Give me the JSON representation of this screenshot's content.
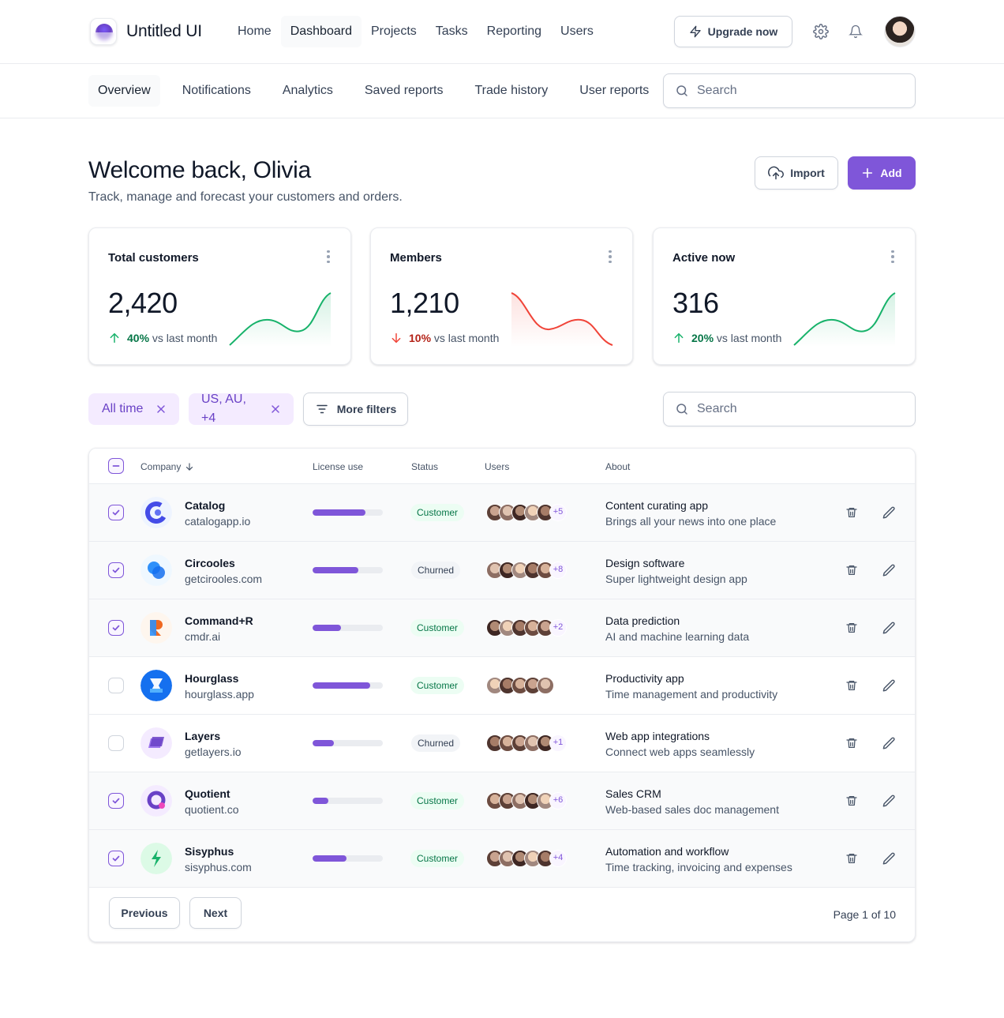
{
  "app": {
    "name": "Untitled UI"
  },
  "nav": {
    "items": [
      {
        "label": "Home",
        "active": false
      },
      {
        "label": "Dashboard",
        "active": true
      },
      {
        "label": "Projects",
        "active": false
      },
      {
        "label": "Tasks",
        "active": false
      },
      {
        "label": "Reporting",
        "active": false
      },
      {
        "label": "Users",
        "active": false
      }
    ],
    "upgrade_label": "Upgrade now",
    "icons": [
      "zap-icon",
      "settings-icon",
      "bell-icon"
    ]
  },
  "subnav": {
    "items": [
      {
        "label": "Overview",
        "active": true
      },
      {
        "label": "Notifications",
        "active": false
      },
      {
        "label": "Analytics",
        "active": false
      },
      {
        "label": "Saved reports",
        "active": false
      },
      {
        "label": "Trade history",
        "active": false
      },
      {
        "label": "User reports",
        "active": false
      }
    ],
    "search_placeholder": "Search"
  },
  "header": {
    "title": "Welcome back, Olivia",
    "subtitle": "Track, manage and forecast your customers and orders.",
    "import_label": "Import",
    "add_label": "Add"
  },
  "metrics": [
    {
      "title": "Total customers",
      "value": "2,420",
      "pct": "40%",
      "trend_text": "vs last month",
      "direction": "up",
      "color": "#17b26a"
    },
    {
      "title": "Members",
      "value": "1,210",
      "pct": "10%",
      "trend_text": "vs last month",
      "direction": "down",
      "color": "#f04438"
    },
    {
      "title": "Active now",
      "value": "316",
      "pct": "20%",
      "trend_text": "vs last month",
      "direction": "up",
      "color": "#17b26a"
    }
  ],
  "filters": {
    "chips": [
      {
        "label": "All time"
      },
      {
        "label": "US, AU, +4"
      }
    ],
    "more_label": "More filters",
    "search_placeholder": "Search"
  },
  "table": {
    "columns": {
      "company": "Company",
      "license": "License use",
      "status": "Status",
      "users": "Users",
      "about": "About"
    },
    "rows": [
      {
        "name": "Catalog",
        "domain": "catalogapp.io",
        "license": 0.75,
        "status": "Customer",
        "extra_users": "+5",
        "about_title": "Content curating app",
        "about_desc": "Brings all your news into one place",
        "checked": true,
        "logo": "catalog"
      },
      {
        "name": "Circooles",
        "domain": "getcirooles.com",
        "license": 0.65,
        "status": "Churned",
        "extra_users": "+8",
        "about_title": "Design software",
        "about_desc": "Super lightweight design app",
        "checked": true,
        "logo": "circooles"
      },
      {
        "name": "Command+R",
        "domain": "cmdr.ai",
        "license": 0.4,
        "status": "Customer",
        "extra_users": "+2",
        "about_title": "Data prediction",
        "about_desc": "AI and machine learning data",
        "checked": true,
        "logo": "commandr"
      },
      {
        "name": "Hourglass",
        "domain": "hourglass.app",
        "license": 0.82,
        "status": "Customer",
        "extra_users": "",
        "about_title": "Productivity app",
        "about_desc": "Time management and productivity",
        "checked": false,
        "logo": "hourglass"
      },
      {
        "name": "Layers",
        "domain": "getlayers.io",
        "license": 0.3,
        "status": "Churned",
        "extra_users": "+1",
        "about_title": "Web app integrations",
        "about_desc": "Connect web apps seamlessly",
        "checked": false,
        "logo": "layers"
      },
      {
        "name": "Quotient",
        "domain": "quotient.co",
        "license": 0.22,
        "status": "Customer",
        "extra_users": "+6",
        "about_title": "Sales CRM",
        "about_desc": "Web-based sales doc management",
        "checked": true,
        "logo": "quotient"
      },
      {
        "name": "Sisyphus",
        "domain": "sisyphus.com",
        "license": 0.48,
        "status": "Customer",
        "extra_users": "+4",
        "about_title": "Automation and workflow",
        "about_desc": "Time tracking, invoicing and expenses",
        "checked": true,
        "logo": "sisyphus"
      }
    ],
    "prev_label": "Previous",
    "next_label": "Next",
    "page_info": "Page 1 of 10"
  }
}
